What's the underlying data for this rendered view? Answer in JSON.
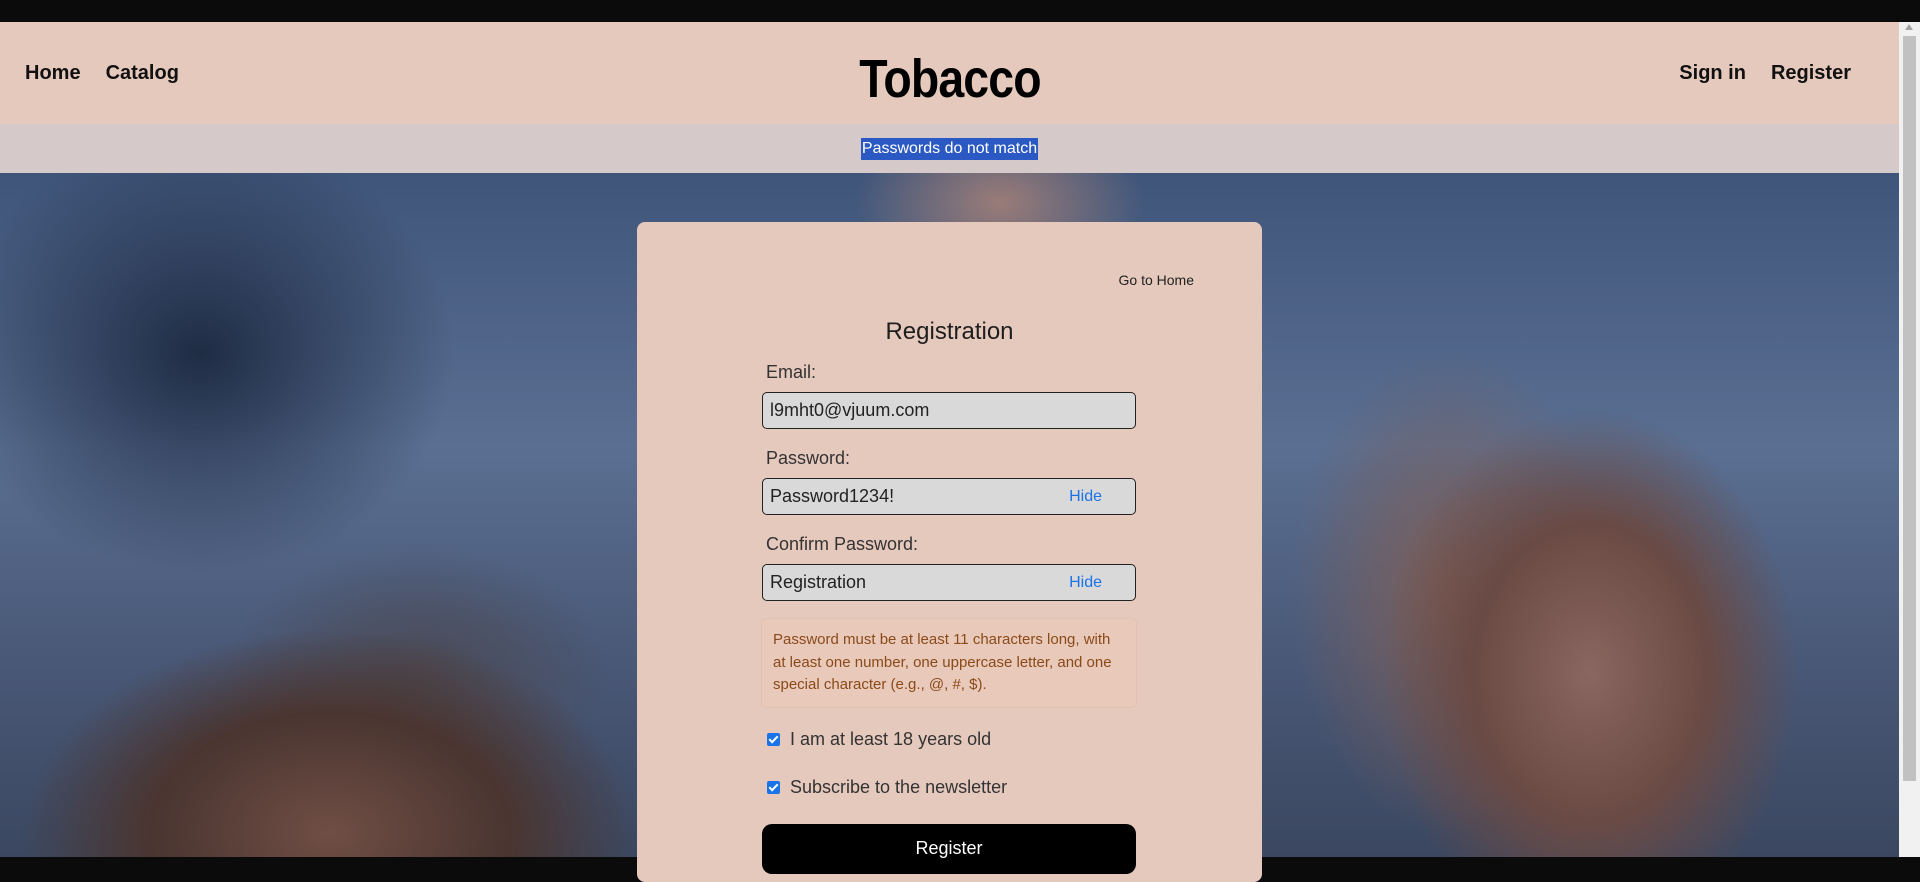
{
  "nav": {
    "left_links": [
      "Home",
      "Catalog"
    ],
    "brand": "Tobacco",
    "right_links": [
      "Sign in",
      "Register"
    ]
  },
  "alert": {
    "message": "Passwords do not match"
  },
  "form": {
    "go_home": "Go to Home",
    "title": "Registration",
    "email_label": "Email:",
    "email_value": "l9mht0@vjuum.com",
    "password_label": "Password:",
    "password_value": "Password1234!",
    "password_toggle": "Hide",
    "confirm_label": "Confirm Password:",
    "confirm_value": "Registration",
    "confirm_toggle": "Hide",
    "hint": "Password must be at least 11 characters long, with at least one number, one uppercase letter, and one special character (e.g., @, #, $).",
    "age_check_label": "I am at least 18 years old",
    "age_checked": true,
    "newsletter_label": "Subscribe to the newsletter",
    "newsletter_checked": true,
    "submit_label": "Register"
  },
  "colors": {
    "nav_bg": "#e6c9bd",
    "alert_highlight": "#2b59c3",
    "link_blue": "#1a73e8",
    "hint_text": "#8a4a1a"
  }
}
